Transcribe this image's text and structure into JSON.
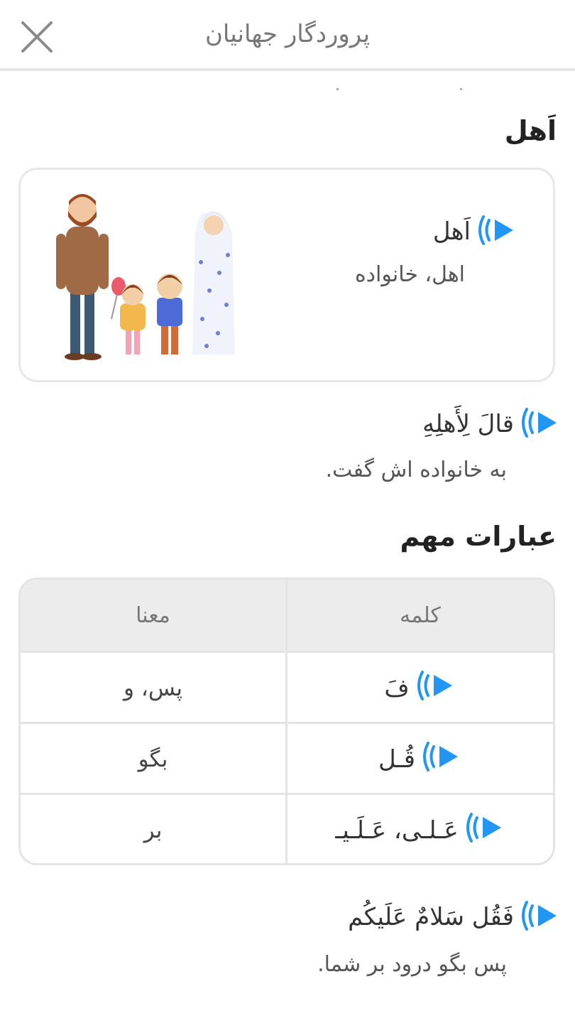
{
  "header": {
    "title": "پروردگار جهانیان",
    "close_icon": "close-icon"
  },
  "section1": {
    "title": "اَهل",
    "card": {
      "word": "اَهل",
      "meaning": "اهل، خانواده",
      "image_icon": "family-illustration"
    }
  },
  "sentence1": {
    "arabic": "قالَ لِأَهلِهِ",
    "translation": "به خانواده اش گفت."
  },
  "section2": {
    "title": "عبارات مهم",
    "table": {
      "headers": {
        "word": "کلمه",
        "meaning": "معنا"
      },
      "rows": [
        {
          "word": "فَ",
          "meaning": "پس، و"
        },
        {
          "word": "قُـل",
          "meaning": "بگو"
        },
        {
          "word": "عَـلـی، عَـلَـیـ",
          "meaning": "بر"
        }
      ]
    }
  },
  "sentence2": {
    "arabic": "فَقُل سَلامٌ عَلَیکُم",
    "translation": "پس بگو درود بر شما."
  },
  "colors": {
    "accent": "#2196f3",
    "border": "#e6e6e6",
    "table_header_bg": "#ececec"
  }
}
